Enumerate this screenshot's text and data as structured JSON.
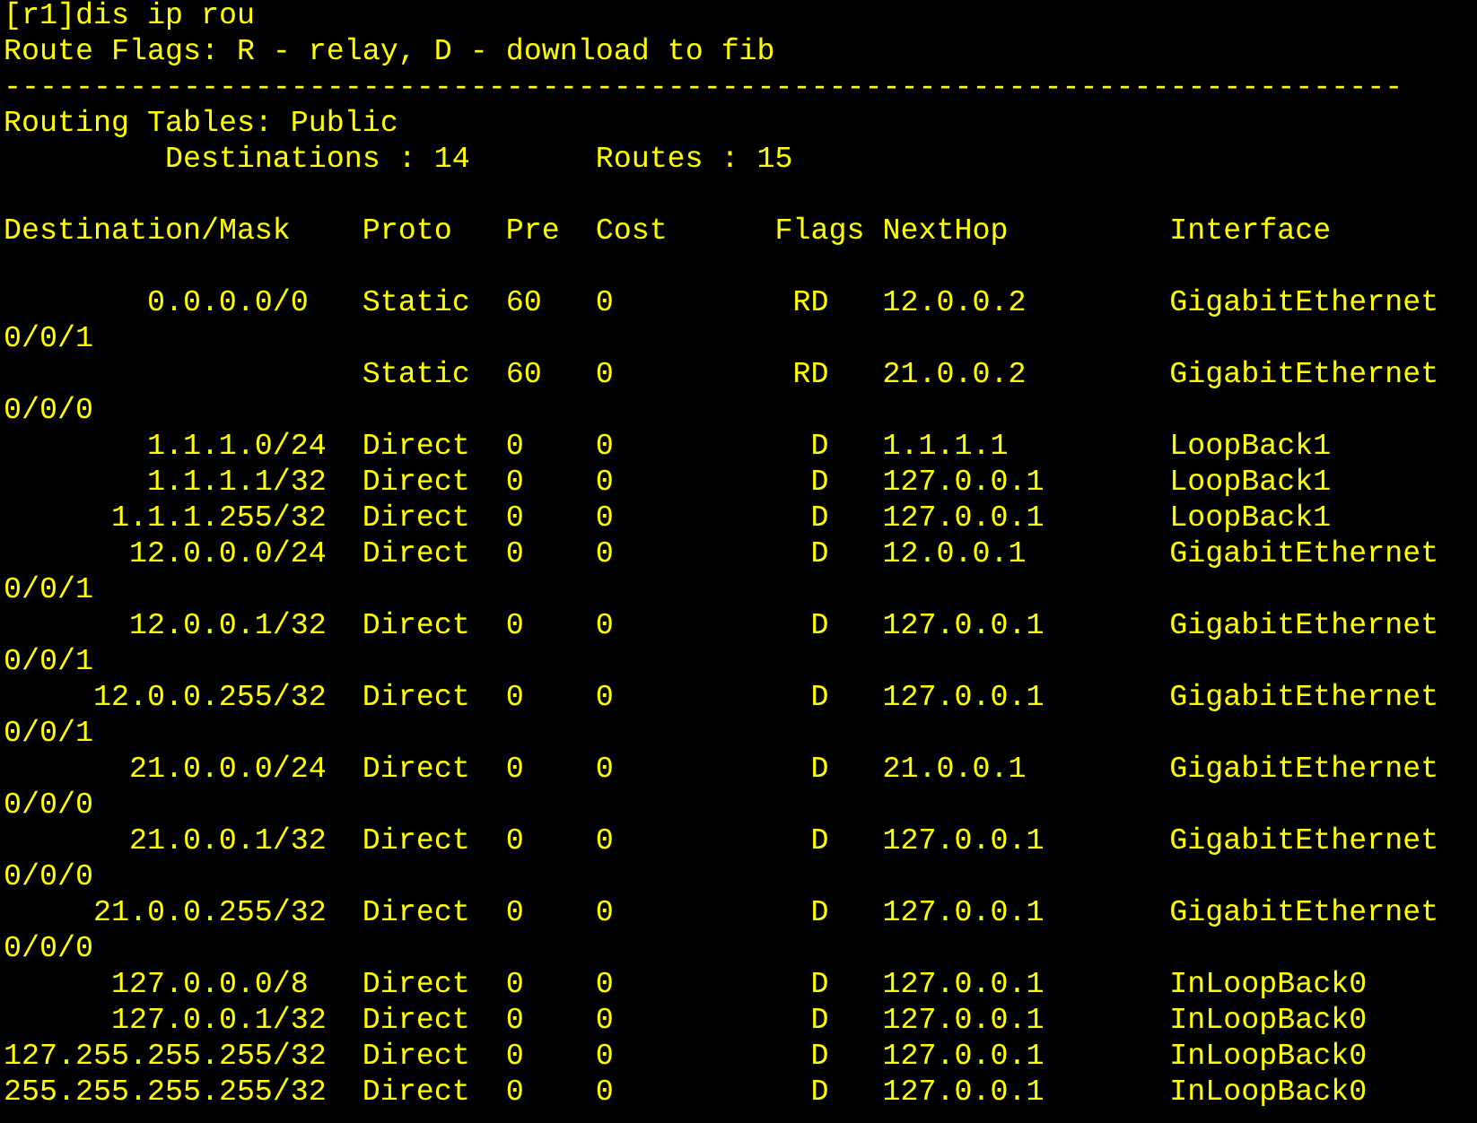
{
  "command": "[r1]dis ip rou",
  "legend": "Route Flags: R - relay, D - download to fib",
  "separator": "------------------------------------------------------------------------------",
  "table_name": "Routing Tables: Public",
  "summary": {
    "destinations": "Destinations : 14",
    "routes": "Routes : 15"
  },
  "columns": [
    "Destination/Mask",
    "Proto",
    "Pre",
    "Cost",
    "Flags",
    "NextHop",
    "Interface"
  ],
  "rows": [
    {
      "destination": "0.0.0.0/0",
      "proto": "Static",
      "pre": "60",
      "cost": "0",
      "flags": "RD",
      "nexthop": "12.0.0.2",
      "interface": "GigabitEthernet",
      "interface_wrap": "0/0/1"
    },
    {
      "proto": "Static",
      "pre": "60",
      "cost": "0",
      "flags": "RD",
      "nexthop": "21.0.0.2",
      "interface": "GigabitEthernet",
      "interface_wrap": "0/0/0"
    },
    {
      "destination": "1.1.1.0/24",
      "proto": "Direct",
      "pre": "0",
      "cost": "0",
      "flags": "D",
      "nexthop": "1.1.1.1",
      "interface": "LoopBack1"
    },
    {
      "destination": "1.1.1.1/32",
      "proto": "Direct",
      "pre": "0",
      "cost": "0",
      "flags": "D",
      "nexthop": "127.0.0.1",
      "interface": "LoopBack1"
    },
    {
      "destination": "1.1.1.255/32",
      "proto": "Direct",
      "pre": "0",
      "cost": "0",
      "flags": "D",
      "nexthop": "127.0.0.1",
      "interface": "LoopBack1"
    },
    {
      "destination": "12.0.0.0/24",
      "proto": "Direct",
      "pre": "0",
      "cost": "0",
      "flags": "D",
      "nexthop": "12.0.0.1",
      "interface": "GigabitEthernet",
      "interface_wrap": "0/0/1"
    },
    {
      "destination": "12.0.0.1/32",
      "proto": "Direct",
      "pre": "0",
      "cost": "0",
      "flags": "D",
      "nexthop": "127.0.0.1",
      "interface": "GigabitEthernet",
      "interface_wrap": "0/0/1"
    },
    {
      "destination": "12.0.0.255/32",
      "proto": "Direct",
      "pre": "0",
      "cost": "0",
      "flags": "D",
      "nexthop": "127.0.0.1",
      "interface": "GigabitEthernet",
      "interface_wrap": "0/0/1"
    },
    {
      "destination": "21.0.0.0/24",
      "proto": "Direct",
      "pre": "0",
      "cost": "0",
      "flags": "D",
      "nexthop": "21.0.0.1",
      "interface": "GigabitEthernet",
      "interface_wrap": "0/0/0"
    },
    {
      "destination": "21.0.0.1/32",
      "proto": "Direct",
      "pre": "0",
      "cost": "0",
      "flags": "D",
      "nexthop": "127.0.0.1",
      "interface": "GigabitEthernet",
      "interface_wrap": "0/0/0"
    },
    {
      "destination": "21.0.0.255/32",
      "proto": "Direct",
      "pre": "0",
      "cost": "0",
      "flags": "D",
      "nexthop": "127.0.0.1",
      "interface": "GigabitEthernet",
      "interface_wrap": "0/0/0"
    },
    {
      "destination": "127.0.0.0/8",
      "proto": "Direct",
      "pre": "0",
      "cost": "0",
      "flags": "D",
      "nexthop": "127.0.0.1",
      "interface": "InLoopBack0"
    },
    {
      "destination": "127.0.0.1/32",
      "proto": "Direct",
      "pre": "0",
      "cost": "0",
      "flags": "D",
      "nexthop": "127.0.0.1",
      "interface": "InLoopBack0"
    },
    {
      "destination": "127.255.255.255/32",
      "proto": "Direct",
      "pre": "0",
      "cost": "0",
      "flags": "D",
      "nexthop": "127.0.0.1",
      "interface": "InLoopBack0"
    },
    {
      "destination": "255.255.255.255/32",
      "proto": "Direct",
      "pre": "0",
      "cost": "0",
      "flags": "D",
      "nexthop": "127.0.0.1",
      "interface": "InLoopBack0"
    }
  ]
}
